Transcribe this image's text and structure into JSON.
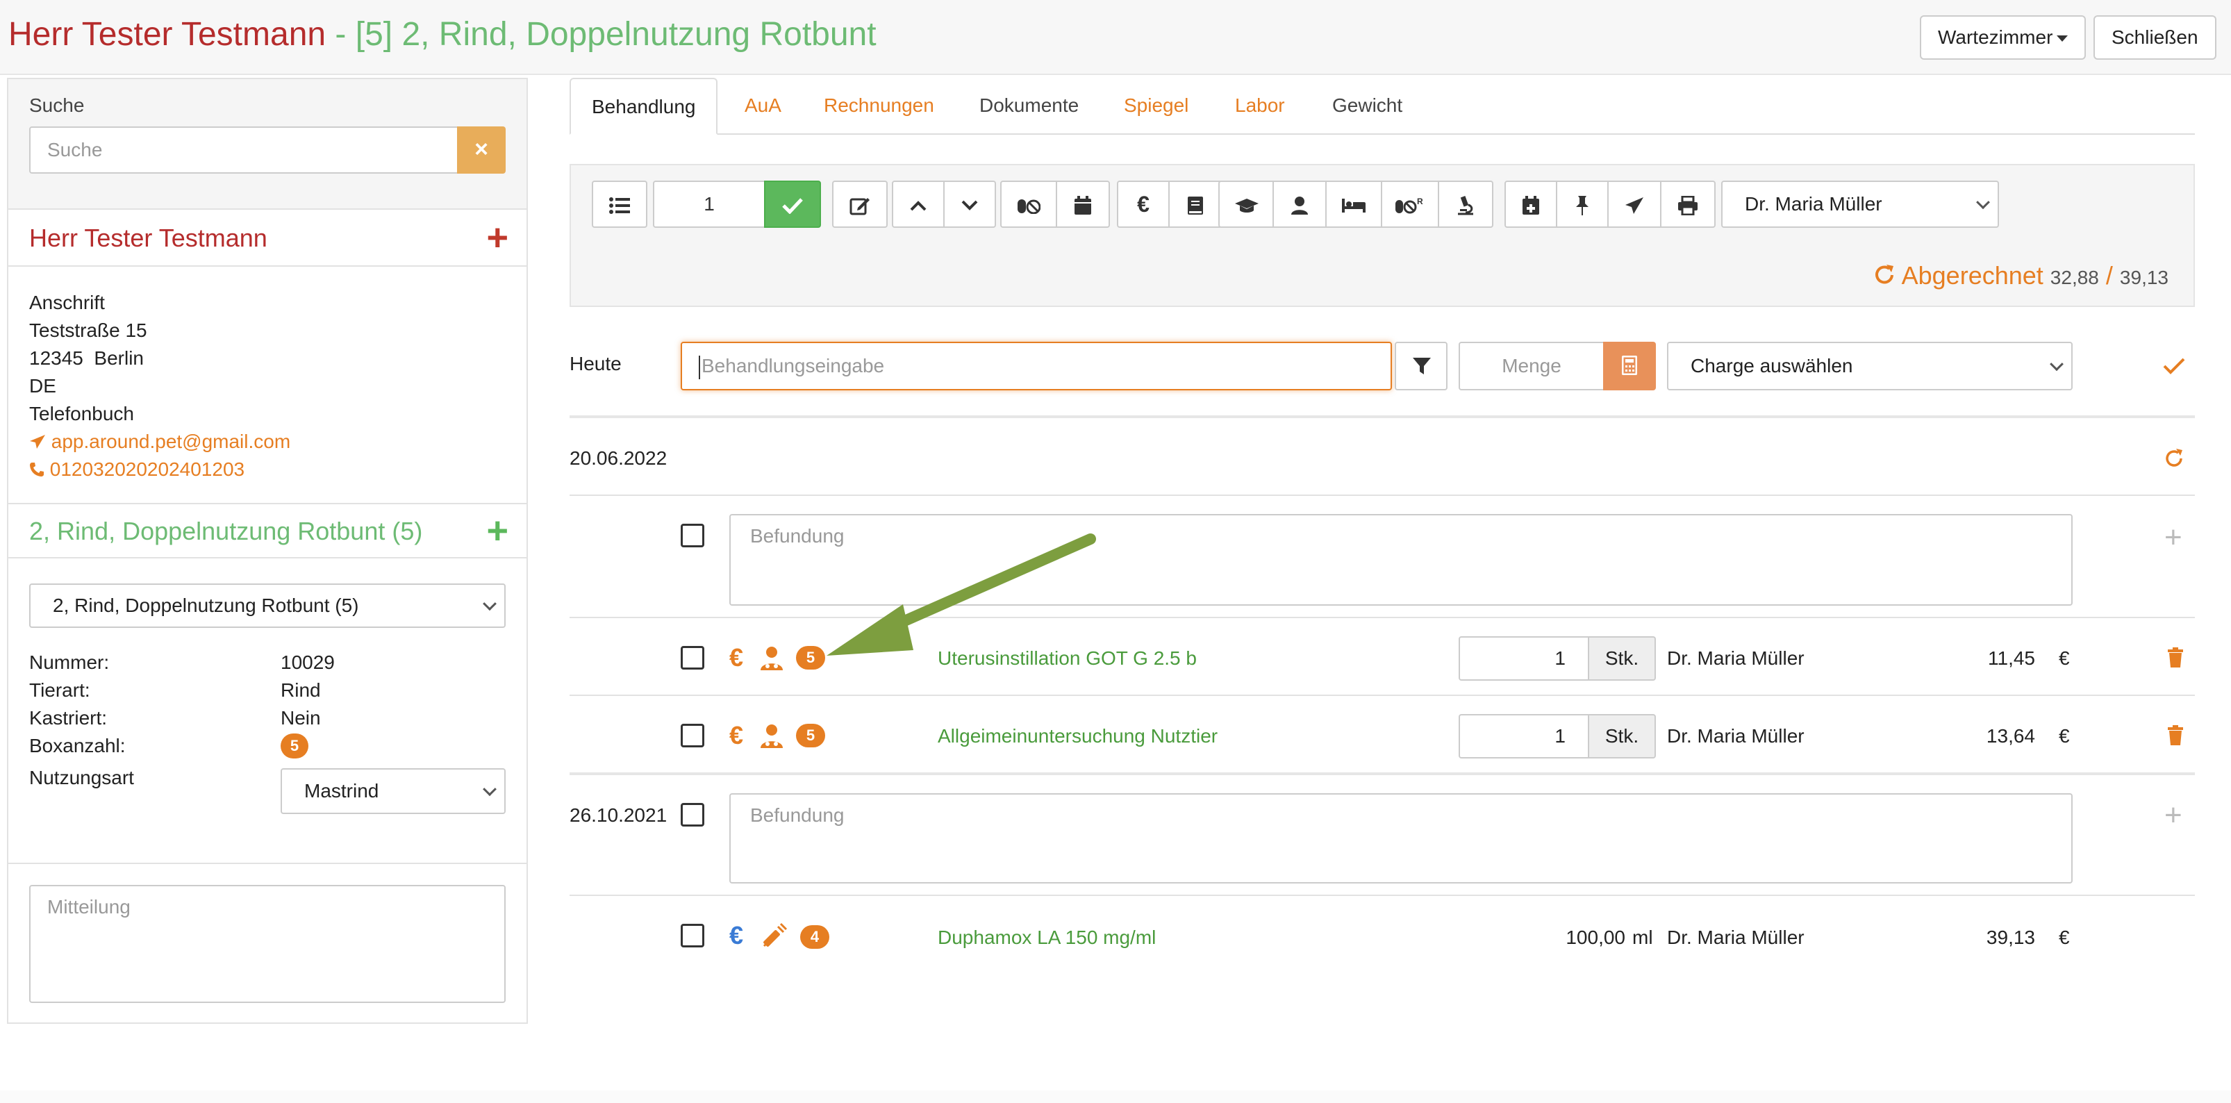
{
  "header": {
    "patient_name": "Herr Tester Testmann",
    "separator": " - ",
    "animal_title": "[5] 2, Rind, Doppelnutzung Rotbunt",
    "wartezimmer_label": "Wartezimmer",
    "schliessen_label": "Schließen"
  },
  "sidebar": {
    "search_label": "Suche",
    "search_placeholder": "Suche",
    "search_clear": "×",
    "owner_name": "Herr Tester Testmann",
    "address": {
      "heading": "Anschrift",
      "street": "Teststraße 15",
      "city": "12345  Berlin",
      "country": "DE",
      "phonebook": "Telefonbuch",
      "email": "app.around.pet@gmail.com",
      "phone": "012032020202401203"
    },
    "animal_name": "2, Rind, Doppelnutzung Rotbunt (5)",
    "animal_select": "2, Rind, Doppelnutzung Rotbunt (5)",
    "info": {
      "nummer_label": "Nummer:",
      "nummer": "10029",
      "tierart_label": "Tierart:",
      "tierart": "Rind",
      "kastriert_label": "Kastriert:",
      "kastriert": "Nein",
      "boxanzahl_label": "Boxanzahl:",
      "boxanzahl": "5",
      "nutzungsart_label": "Nutzungsart",
      "nutzungsart": "Mastrind"
    },
    "mitteilung_placeholder": "Mitteilung"
  },
  "tabs": [
    {
      "label": "Behandlung",
      "active": true
    },
    {
      "label": "AuA"
    },
    {
      "label": "Rechnungen"
    },
    {
      "label": "Dokumente"
    },
    {
      "label": "Spiegel"
    },
    {
      "label": "Labor"
    },
    {
      "label": "Gewicht"
    }
  ],
  "toolbar": {
    "count_value": "1",
    "doctor": "Dr. Maria Müller",
    "abgerechnet_label": "Abgerechnet",
    "abgerechnet_value": "32,88",
    "abgerechnet_sep": "/",
    "abgerechnet_total": "39,13",
    "icons": [
      "list-icon",
      "check-icon",
      "edit-icon",
      "chevron-up-icon",
      "chevron-down-icon",
      "pills-icon",
      "calendar-icon",
      "euro-icon",
      "book-icon",
      "graduation-cap-icon",
      "user-icon",
      "bed-icon",
      "pills-rx-icon",
      "microscope-icon",
      "calendar-plus-icon",
      "pin-icon",
      "send-icon",
      "print-icon"
    ]
  },
  "entry": {
    "heute_label": "Heute",
    "behandlung_placeholder": "Behandlungseingabe",
    "menge_placeholder": "Menge",
    "charge_placeholder": "Charge auswählen"
  },
  "groups": [
    {
      "date": "20.06.2022",
      "befund_placeholder": "Befundung",
      "items": [
        {
          "badge": "5",
          "name": "Uterusinstillation GOT G 2.5 b",
          "qty": "1",
          "unit": "Stk.",
          "doctor": "Dr. Maria Müller",
          "price": "11,45",
          "currency": "€"
        },
        {
          "badge": "5",
          "name": "Allgeimeinuntersuchung Nutztier",
          "qty": "1",
          "unit": "Stk.",
          "doctor": "Dr. Maria Müller",
          "price": "13,64",
          "currency": "€"
        }
      ]
    },
    {
      "date": "26.10.2021",
      "befund_placeholder": "Befundung",
      "items": [
        {
          "badge": "4",
          "name": "Duphamox LA 150 mg/ml",
          "qty": "100,00",
          "unit": "ml",
          "doctor": "Dr. Maria Müller",
          "price": "39,13",
          "currency": "€"
        }
      ]
    }
  ],
  "colors": {
    "accent": "#e67e22",
    "owner": "#b52c2c",
    "animal": "#6dbb74",
    "item_green": "#4a9b3c",
    "annotation_arrow": "#7d9e3f",
    "billed_blue": "#3a7bd5"
  }
}
